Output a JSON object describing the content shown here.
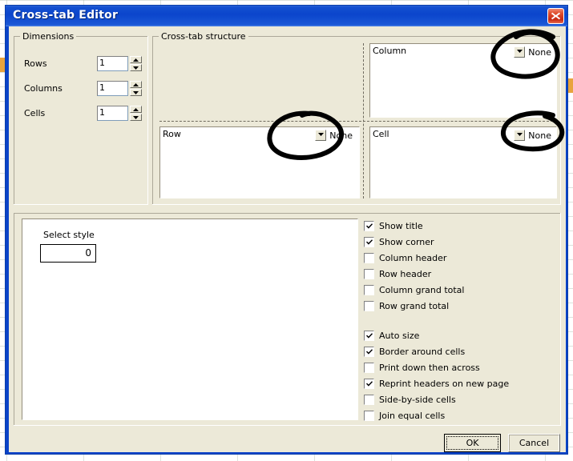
{
  "window": {
    "title": "Cross-tab Editor",
    "close_icon": "close-icon",
    "titlebar_color": "#0a43c8",
    "client_color": "#ece9d8"
  },
  "dimensions": {
    "group_title": "Dimensions",
    "fields": [
      {
        "label": "Rows",
        "value": "1"
      },
      {
        "label": "Columns",
        "value": "1"
      },
      {
        "label": "Cells",
        "value": "1"
      }
    ],
    "spinner_up_icon": "triangle-up-icon",
    "spinner_down_icon": "triangle-down-icon"
  },
  "structure": {
    "group_title": "Cross-tab structure",
    "quadrants": [
      {
        "label": "Column",
        "dropdown_value": "None",
        "dropdown_icon": "chevron-down-icon",
        "annotated": true
      },
      {
        "label": "Row",
        "dropdown_value": "None",
        "dropdown_icon": "chevron-down-icon",
        "annotated": true
      },
      {
        "label": "Cell",
        "dropdown_value": "None",
        "dropdown_icon": "chevron-down-icon",
        "annotated": true
      }
    ]
  },
  "style": {
    "label": "Select style",
    "value": "0"
  },
  "options": {
    "group_a": [
      {
        "label": "Show title",
        "checked": true
      },
      {
        "label": "Show corner",
        "checked": true
      },
      {
        "label": "Column header",
        "checked": false
      },
      {
        "label": "Row header",
        "checked": false
      },
      {
        "label": "Column grand total",
        "checked": false
      },
      {
        "label": "Row grand total",
        "checked": false
      }
    ],
    "group_b": [
      {
        "label": "Auto size",
        "checked": true
      },
      {
        "label": "Border around cells",
        "checked": true
      },
      {
        "label": "Print down then across",
        "checked": false
      },
      {
        "label": "Reprint headers on new page",
        "checked": true
      },
      {
        "label": "Side-by-side cells",
        "checked": false
      },
      {
        "label": "Join equal cells",
        "checked": false
      }
    ],
    "check_icon": "check-icon"
  },
  "footer": {
    "ok_label": "OK",
    "cancel_label": "Cancel"
  },
  "annotations": {
    "color": "#000000",
    "marks": [
      "circle-around-column-dropdown",
      "circle-around-row-dropdown",
      "circle-around-cell-dropdown"
    ]
  }
}
